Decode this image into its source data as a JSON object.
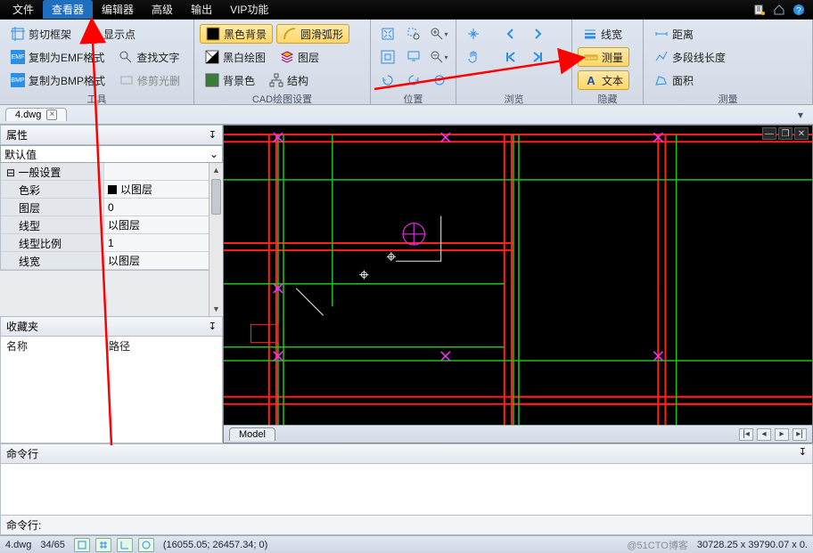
{
  "menu": {
    "items": [
      "文件",
      "查看器",
      "编辑器",
      "高级",
      "输出",
      "VIP功能"
    ],
    "selected_index": 1
  },
  "ribbon": {
    "groups": [
      {
        "label": "工具",
        "items": [
          {
            "icon": "crop",
            "label": "剪切框架"
          },
          {
            "icon": "target",
            "label": "显示点"
          },
          {
            "icon": "emf",
            "label": "复制为EMF格式"
          },
          {
            "icon": "find",
            "label": "查找文字"
          },
          {
            "icon": "bmp",
            "label": "复制为BMP格式"
          },
          {
            "icon": "trim",
            "label": "修剪光删",
            "dim": true
          }
        ]
      },
      {
        "label": "CAD绘图设置",
        "items": [
          {
            "icon": "bg-black",
            "label": "黑色背景",
            "hl": true
          },
          {
            "icon": "arc",
            "label": "圆滑弧形",
            "hl": true
          },
          {
            "icon": "bw",
            "label": "黑白绘图"
          },
          {
            "icon": "layers",
            "label": "图层"
          },
          {
            "icon": "bgcolor",
            "label": "背景色"
          },
          {
            "icon": "struct",
            "label": "结构"
          }
        ]
      },
      {
        "label": "位置",
        "icons_only": true
      },
      {
        "label": "浏览",
        "icons_only": true
      },
      {
        "label": "隐藏",
        "items": [
          {
            "icon": "lw",
            "label": "线宽"
          },
          {
            "icon": "measure",
            "label": "测量",
            "hl": true
          },
          {
            "icon": "text",
            "label": "文本",
            "hl": true
          }
        ]
      },
      {
        "label": "测量",
        "items": [
          {
            "icon": "dist",
            "label": "距离"
          },
          {
            "icon": "poly",
            "label": "多段线长度"
          },
          {
            "icon": "area",
            "label": "面积"
          }
        ]
      }
    ]
  },
  "doc_tab": {
    "name": "4.dwg"
  },
  "properties": {
    "title": "属性",
    "combo": "默认值",
    "section": "一般设置",
    "rows": [
      {
        "k": "色彩",
        "v": "以图层",
        "swatch": true
      },
      {
        "k": "图层",
        "v": "0"
      },
      {
        "k": "线型",
        "v": "以图层"
      },
      {
        "k": "线型比例",
        "v": "1"
      },
      {
        "k": "线宽",
        "v": "以图层"
      }
    ]
  },
  "favorites": {
    "title": "收藏夹",
    "col1": "名称",
    "col2": "路径"
  },
  "canvas": {
    "model_tab": "Model"
  },
  "command": {
    "title": "命令行",
    "prompt": "命令行:"
  },
  "status": {
    "file": "4.dwg",
    "pages": "34/65",
    "coords": "(16055.05; 26457.34; 0)",
    "right": "30728.25 x 39790.07 x 0.",
    "watermark": "@51CTO博客"
  }
}
